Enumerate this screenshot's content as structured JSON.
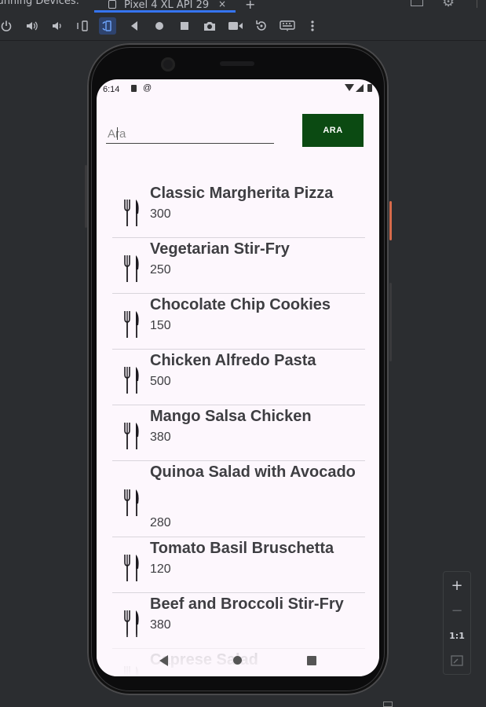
{
  "ide": {
    "tabs": [
      {
        "label": "Running Devices:"
      },
      {
        "label": "Pixel 4 XL API 29",
        "close": "×"
      }
    ],
    "add_tab": "+",
    "toolbar_icons": [
      "power-icon",
      "volume-up-icon",
      "volume-down-icon",
      "rotate-left-icon",
      "rotate-right-icon",
      "back-icon",
      "home-icon",
      "overview-icon",
      "camera-icon",
      "screen-record-icon",
      "restore-icon",
      "keyboard-icon",
      "more-icon"
    ],
    "zoom": {
      "in": "+",
      "out": "−",
      "actual": "1:1"
    }
  },
  "device": {
    "status_bar": {
      "time": "6:14"
    },
    "search": {
      "placeholder": "Ara",
      "value": "",
      "button_label": "ARA"
    },
    "recipes": [
      {
        "title": "Classic Margherita Pizza",
        "calories": "300"
      },
      {
        "title": "Vegetarian Stir-Fry",
        "calories": "250"
      },
      {
        "title": "Chocolate Chip Cookies",
        "calories": "150"
      },
      {
        "title": "Chicken Alfredo Pasta",
        "calories": "500"
      },
      {
        "title": "Mango Salsa Chicken",
        "calories": "380"
      },
      {
        "title": "Quinoa Salad with Avocado",
        "calories": "280"
      },
      {
        "title": "Tomato Basil Bruschetta",
        "calories": "120"
      },
      {
        "title": "Beef and Broccoli Stir-Fry",
        "calories": "380"
      },
      {
        "title": "Caprese Salad",
        "calories": ""
      }
    ],
    "colors": {
      "button": "#0b4a12",
      "screen_bg": "#fdf7fd",
      "text": "#3e3e42"
    }
  }
}
